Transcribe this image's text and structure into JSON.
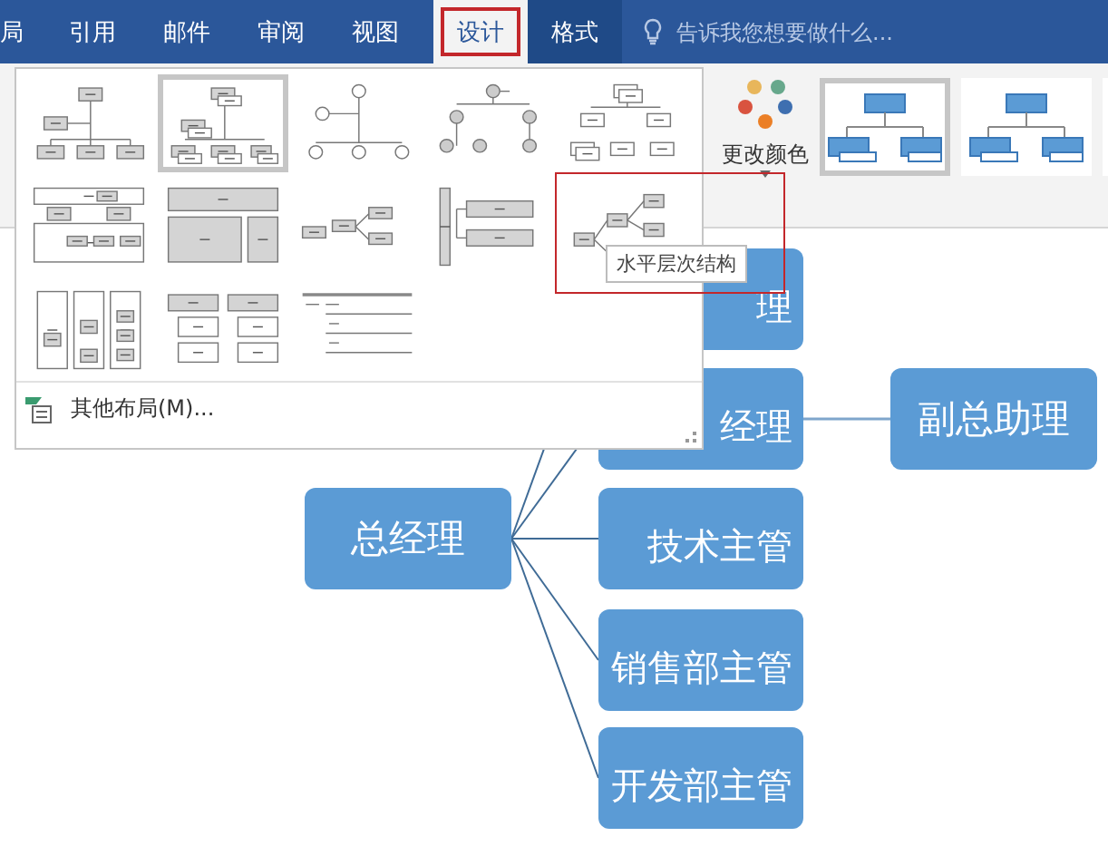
{
  "ribbon_tabs": [
    {
      "label": "局",
      "selected": false,
      "contextual": false,
      "marked": false
    },
    {
      "label": "引用",
      "selected": false,
      "contextual": false,
      "marked": false
    },
    {
      "label": "邮件",
      "selected": false,
      "contextual": false,
      "marked": false
    },
    {
      "label": "审阅",
      "selected": false,
      "contextual": false,
      "marked": false
    },
    {
      "label": "视图",
      "selected": false,
      "contextual": false,
      "marked": false
    },
    {
      "label": "设计",
      "selected": true,
      "contextual": true,
      "marked": true
    },
    {
      "label": "格式",
      "selected": false,
      "contextual": true,
      "marked": false
    }
  ],
  "tell_me": {
    "placeholder": "告诉我您想要做什么..."
  },
  "layout_gallery": {
    "items": [
      {
        "kind": "org",
        "selected": false,
        "marked": false
      },
      {
        "kind": "name-org",
        "selected": true,
        "marked": false
      },
      {
        "kind": "circle",
        "selected": false,
        "marked": false
      },
      {
        "kind": "circle-label",
        "selected": false,
        "marked": false
      },
      {
        "kind": "stacked",
        "selected": false,
        "marked": false
      },
      {
        "kind": "table-org",
        "selected": false,
        "marked": false
      },
      {
        "kind": "blocks",
        "selected": false,
        "marked": false
      },
      {
        "kind": "horizontal-labeled",
        "selected": false,
        "marked": false
      },
      {
        "kind": "bracket",
        "selected": false,
        "marked": false
      },
      {
        "kind": "horizontal",
        "selected": false,
        "marked": true
      },
      {
        "kind": "columns",
        "selected": false,
        "marked": false
      },
      {
        "kind": "two-lists",
        "selected": false,
        "marked": false
      },
      {
        "kind": "lined-list",
        "selected": false,
        "marked": false
      }
    ],
    "tooltip": "水平层次结构",
    "more_layouts": "其他布局(M)..."
  },
  "change_colors": {
    "label": "更改颜色"
  },
  "style_gallery": {
    "items": [
      {
        "selected": true
      },
      {
        "selected": false
      },
      {
        "selected": false
      }
    ]
  },
  "diagram": {
    "root": {
      "text": "总经理",
      "children": [
        {
          "text": "理"
        },
        {
          "text": "经理",
          "children": [
            {
              "text": "副总助理"
            }
          ]
        },
        {
          "text": "技术主管"
        },
        {
          "text": "销售部主管"
        },
        {
          "text": "开发部主管"
        }
      ]
    }
  }
}
